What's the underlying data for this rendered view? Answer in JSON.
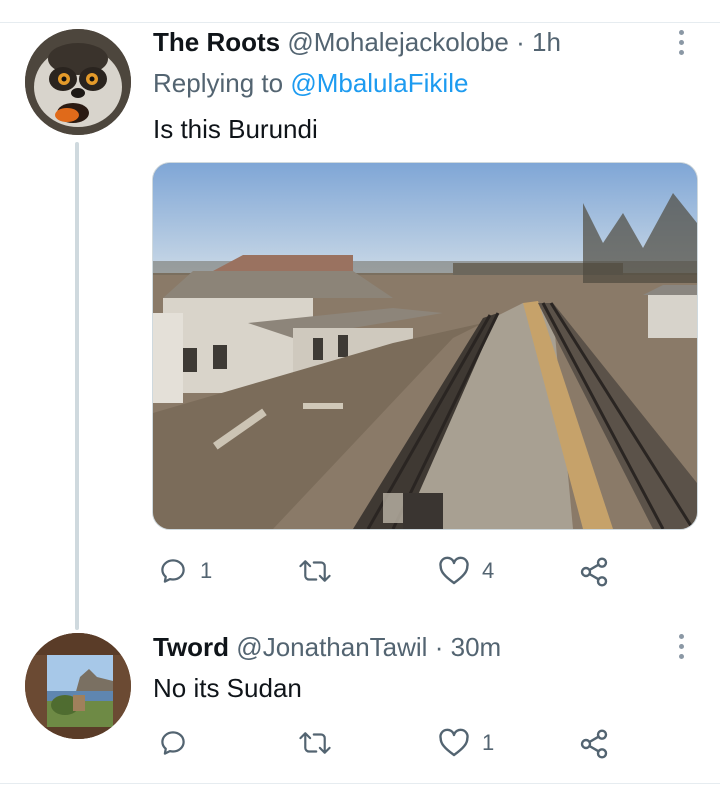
{
  "tweets": [
    {
      "name": "The Roots",
      "handle": "@Mohalejackolobe",
      "separator": "·",
      "time": "1h",
      "reply_label": "Replying to",
      "reply_mention": "@MbalulaFikile",
      "text": "Is this Burundi",
      "avatar_icon": "lemur-avatar",
      "media_icon": "abandoned-train-station-photo",
      "actions": {
        "reply_count": "1",
        "retweet_count": "",
        "like_count": "4"
      }
    },
    {
      "name": "Tword",
      "handle": "@JonathanTawil",
      "separator": "·",
      "time": "30m",
      "text": "No its Sudan",
      "avatar_icon": "window-landscape-avatar",
      "actions": {
        "reply_count": "",
        "retweet_count": "",
        "like_count": "1"
      }
    }
  ],
  "colors": {
    "text": "#0f1419",
    "secondary": "#536471",
    "link": "#1d9bf0",
    "divider": "#e6ecf0"
  }
}
